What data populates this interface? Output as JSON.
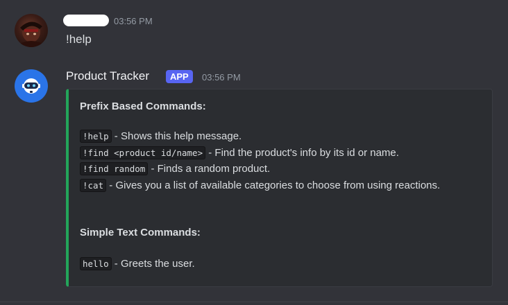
{
  "messages": [
    {
      "author": "",
      "time": "03:56 PM",
      "content": "!help"
    },
    {
      "author": "Product Tracker",
      "tag": "APP",
      "time": "03:56 PM",
      "embed": {
        "prefix_heading": "Prefix Based Commands:",
        "commands": [
          {
            "code": "!help",
            "desc": " - Shows this help message."
          },
          {
            "code": "!find <product id/name>",
            "desc": " - Find the product's info by its id or name."
          },
          {
            "code": "!find random",
            "desc": " - Finds a random product."
          },
          {
            "code": "!cat",
            "desc": " - Gives you a list of available categories to choose from using reactions."
          }
        ],
        "text_heading": "Simple Text Commands:",
        "text_commands": [
          {
            "code": "hello",
            "desc": " - Greets the user."
          }
        ]
      }
    }
  ],
  "icons": {
    "user_avatar": "user-avatar",
    "bot_avatar": "robot-icon"
  },
  "colors": {
    "background": "#323339",
    "embed_accent": "#23a55a",
    "app_tag": "#5865f2",
    "bot_avatar_bg": "#2a74e8"
  }
}
